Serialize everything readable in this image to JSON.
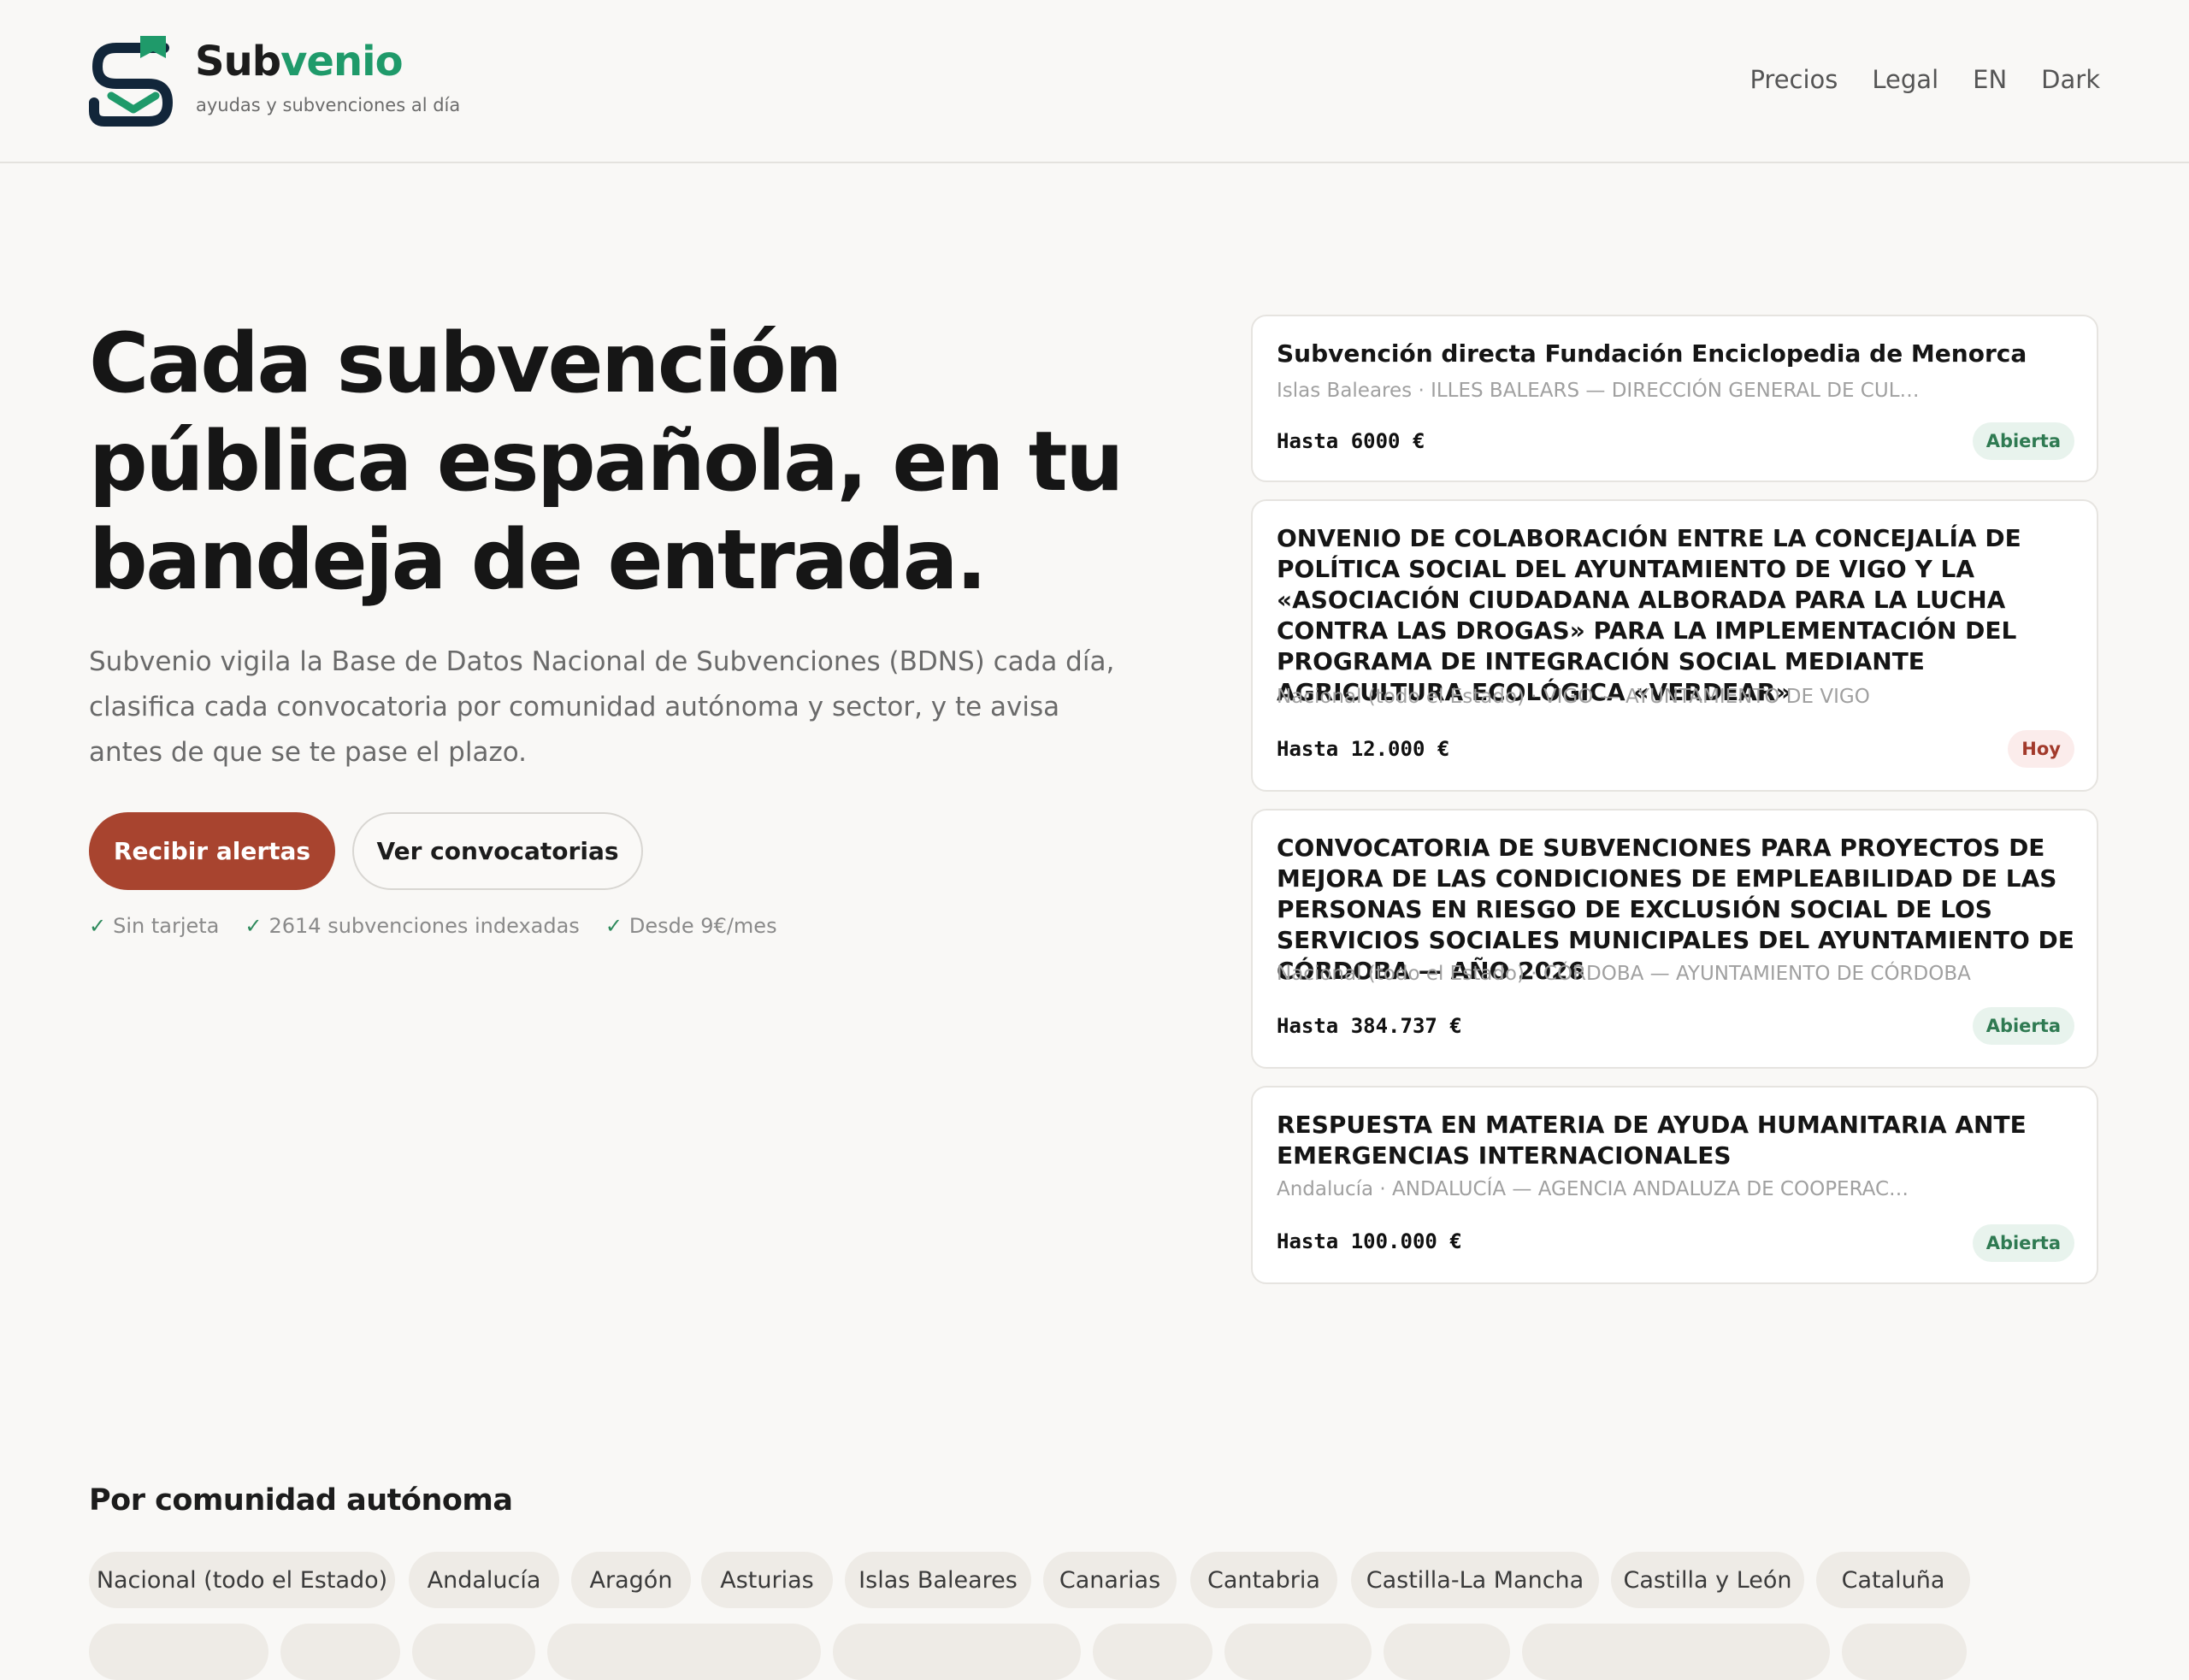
{
  "header": {
    "brand_prefix": "Sub",
    "brand_suffix": "venio",
    "tagline": "ayudas y subvenciones al día",
    "nav": [
      "Precios",
      "Legal",
      "EN",
      "Dark"
    ]
  },
  "hero": {
    "title": "Cada subvención pública española, en tu bandeja de entrada.",
    "lead": "Subvenio vigila la Base de Datos Nacional de Subvenciones (BDNS) cada día, clasifica cada convocatoria por comunidad autónoma y sector, y te avisa antes de que se te pase el plazo.",
    "primary_cta": "Recibir alertas",
    "secondary_cta": "Ver convocatorias",
    "features": [
      "Sin tarjeta",
      "2614 subvenciones indexadas",
      "Desde 9€/mes"
    ]
  },
  "grants": [
    {
      "title": "Subvención directa Fundación Enciclopedia de Menorca",
      "meta": "Islas Baleares · ILLES BALEARS — DIRECCIÓN GENERAL DE CUL…",
      "amount": "Hasta 6000 €",
      "status": "Abierta"
    },
    {
      "title": "ONVENIO DE COLABORACIÓN ENTRE LA CONCEJALÍA DE POLÍTICA SOCIAL DEL AYUNTAMIENTO DE VIGO Y LA «ASOCIACIÓN CIUDADANA ALBORADA PARA LA LUCHA CONTRA LAS DROGAS» PARA LA IMPLEMENTACIÓN DEL PROGRAMA DE INTEGRACIÓN SOCIAL MEDIANTE AGRICULTURA ECOLÓGICA «VERDEAR»",
      "meta": "Nacional (todo el Estado) · VIGO — AYUNTAMIENTO DE VIGO",
      "amount": "Hasta 12.000 €",
      "status": "Hoy"
    },
    {
      "title": "CONVOCATORIA DE SUBVENCIONES PARA PROYECTOS DE MEJORA DE LAS CONDICIONES DE EMPLEABILIDAD DE LAS PERSONAS EN RIESGO DE EXCLUSIÓN SOCIAL DE LOS SERVICIOS SOCIALES MUNICIPALES DEL AYUNTAMIENTO DE CÓRDOBA — AÑO 2026",
      "meta": "Nacional (todo el Estado) · CÓRDOBA — AYUNTAMIENTO DE CÓRDOBA",
      "amount": "Hasta 384.737 €",
      "status": "Abierta"
    },
    {
      "title": "RESPUESTA EN MATERIA DE AYUDA HUMANITARIA ANTE EMERGENCIAS INTERNACIONALES",
      "meta": "Andalucía · ANDALUCÍA — AGENCIA ANDALUZA DE COOPERAC…",
      "amount": "Hasta 100.000 €",
      "status": "Abierta"
    }
  ],
  "regions": {
    "title": "Por comunidad autónoma",
    "items": [
      "Nacional (todo el Estado)",
      "Andalucía",
      "Aragón",
      "Asturias",
      "Islas Baleares",
      "Canarias",
      "Cantabria",
      "Castilla-La Mancha",
      "Castilla y León",
      "Cataluña"
    ]
  },
  "colors": {
    "accent_green": "#1f9a6a",
    "primary_button": "#a8442f",
    "logo_navy": "#12263a"
  }
}
